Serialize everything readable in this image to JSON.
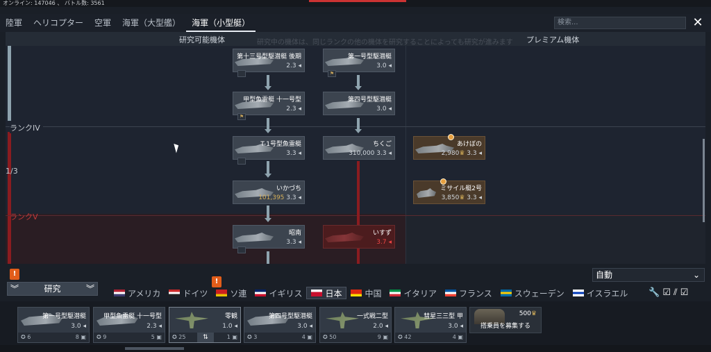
{
  "status": {
    "text": "オンライン: 147046 、 バトル数: 3561"
  },
  "tabs": [
    "陸軍",
    "ヘリコプター",
    "空軍",
    "海軍（大型艦）",
    "海軍（小型艇）"
  ],
  "search": {
    "placeholder": "検索..."
  },
  "headers": {
    "research": "研究可能機体",
    "premium": "プレミアム機体"
  },
  "bg_text": "研究中の機体は、同じランクの他の機体を研究することによっても研究が進みます",
  "ranks": {
    "iv": "ランクIV",
    "v": "ランクV",
    "progress": "1/3"
  },
  "tree": {
    "col1": [
      {
        "name": "第十三号型駆潜艇 後期",
        "br": "2.3",
        "price": ""
      },
      {
        "name": "甲型魚雷艇 十一号型",
        "br": "2.3",
        "price": ""
      },
      {
        "name": "T-1号型魚雷艇",
        "br": "3.3",
        "price": ""
      },
      {
        "name": "いかづち",
        "br": "3.3",
        "price": "101,395"
      },
      {
        "name": "昭南",
        "br": "3.3",
        "price": ""
      }
    ],
    "col2": [
      {
        "name": "第一号型駆潜艇",
        "br": "3.0",
        "price": ""
      },
      {
        "name": "第四号型駆潜艇",
        "br": "3.0",
        "price": ""
      },
      {
        "name": "ちくご",
        "br": "3.3",
        "price": "310,000"
      },
      {
        "name": "いすず",
        "br": "3.7",
        "price": ""
      }
    ],
    "premium": [
      {
        "name": "あけぼの",
        "br": "3.3",
        "price": "2,980"
      },
      {
        "name": "ミサイル艇2号",
        "br": "3.3",
        "price": "3,850"
      }
    ]
  },
  "controls": {
    "auto_label": "自動",
    "research_label": "研究",
    "badge_text": "!"
  },
  "nations": [
    {
      "name": "アメリカ",
      "colors": [
        "#b22234",
        "#ffffff",
        "#3c3b6e"
      ]
    },
    {
      "name": "ドイツ",
      "colors": [
        "#cc2a2a",
        "#ffffff",
        "#222222"
      ]
    },
    {
      "name": "ソ連",
      "colors": [
        "#cc2020",
        "#cc2020",
        "#e8c200"
      ]
    },
    {
      "name": "イギリス",
      "colors": [
        "#012169",
        "#ffffff",
        "#c8102e"
      ]
    },
    {
      "name": "日本",
      "colors": [
        "#ffffff",
        "#c8102e",
        "#c8102e"
      ]
    },
    {
      "name": "中国",
      "colors": [
        "#de2910",
        "#de2910",
        "#ffde00"
      ]
    },
    {
      "name": "イタリア",
      "colors": [
        "#009246",
        "#ffffff",
        "#ce2b37"
      ]
    },
    {
      "name": "フランス",
      "colors": [
        "#0055a4",
        "#ffffff",
        "#ef4135"
      ]
    },
    {
      "name": "スウェーデン",
      "colors": [
        "#006aa7",
        "#fecc00",
        "#006aa7"
      ]
    },
    {
      "name": "イスラエル",
      "colors": [
        "#ffffff",
        "#0038b8",
        "#ffffff"
      ]
    }
  ],
  "crew": [
    {
      "name": "第一号型駆潜艇",
      "br": "3.0",
      "left": "6",
      "right": "8"
    },
    {
      "name": "甲型魚雷艇 十一号型",
      "br": "2.3",
      "left": "9",
      "right": "5"
    },
    {
      "name": "零観",
      "br": "1.0",
      "left": "25",
      "right": "1"
    },
    {
      "name": "第四号型駆潜艇",
      "br": "3.0",
      "left": "3",
      "right": "4"
    },
    {
      "name": "一式戦二型",
      "br": "2.0",
      "left": "50",
      "right": "9"
    },
    {
      "name": "彗星三三型 甲",
      "br": "3.0",
      "left": "42",
      "right": "4"
    }
  ],
  "recruit": {
    "price": "500",
    "label": "搭乗員を募集する"
  }
}
